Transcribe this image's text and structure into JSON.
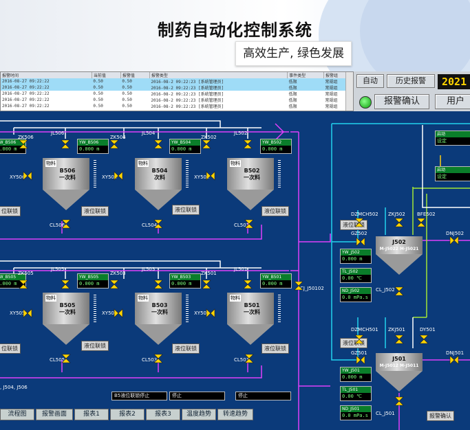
{
  "header": {
    "title": "制药自动化控制系统",
    "subtitle": "高效生产, 绿色发展"
  },
  "alarms": {
    "columns": [
      "报警时间",
      "当前值",
      "报警值",
      "报警类型",
      "事件类型",
      "报警组"
    ],
    "rows": [
      {
        "time": "2016-08-27 09:22:22",
        "cur": "0.50",
        "lim": "0.50",
        "msg": "2016-08-2 09:22:23 [系统管理员]",
        "type": "低限",
        "group": "常规组"
      },
      {
        "time": "2016-08-27 09:22:22",
        "cur": "0.50",
        "lim": "0.50",
        "msg": "2016-08-2 09:22:23 [系统管理员]",
        "type": "低限",
        "group": "常规组"
      },
      {
        "time": "2016-08-27 09:22:22",
        "cur": "0.50",
        "lim": "0.50",
        "msg": "2016-08-2 09:22:23 [系统管理员]",
        "type": "低限",
        "group": "常规组"
      },
      {
        "time": "2016-08-27 09:22:22",
        "cur": "0.50",
        "lim": "0.50",
        "msg": "2016-08-2 09:22:23 [系统管理员]",
        "type": "低限",
        "group": "常规组"
      },
      {
        "time": "2016-08-27 09:22:22",
        "cur": "0.50",
        "lim": "0.50",
        "msg": "2016-08-2 09:22:23 [系统管理员]",
        "type": "低限",
        "group": "常规组"
      }
    ]
  },
  "controls": {
    "btn_auto": "自动",
    "btn_history": "历史报警",
    "clock": "2021",
    "btn_ack": "报警确认",
    "user": "用户"
  },
  "tanks": {
    "b506": {
      "tag": "物料",
      "line1": "B506",
      "line2": "一次料"
    },
    "b504": {
      "tag": "物料",
      "line1": "B504",
      "line2": "次料"
    },
    "b502": {
      "tag": "物料",
      "line1": "B502",
      "line2": "一次料"
    },
    "b505": {
      "tag": "物料",
      "line1": "B505",
      "line2": "一次料"
    },
    "b503": {
      "tag": "物料",
      "line1": "B503",
      "line2": "一次料"
    },
    "b501": {
      "tag": "物料",
      "line1": "B501",
      "line2": "一次料"
    },
    "j502": {
      "tag": "",
      "line1": "J502",
      "line2": "M-J5022 M-J5021"
    },
    "j501": {
      "tag": "",
      "line1": "J501",
      "line2": "M-J5012 M-J5011"
    }
  },
  "labels": {
    "zk506": "ZK506",
    "jl506": "JL506",
    "zk504": "ZK504",
    "jl504": "JL504",
    "zk502": "ZK502",
    "jl502": "JL502",
    "xy506": "XY506",
    "xy504": "XY504",
    "xy502": "XY502",
    "cl506": "CL506",
    "cl504": "CL504",
    "cl502": "CL502",
    "zk505": "ZK505",
    "jl505": "JL505",
    "zk503": "ZK503",
    "jl503": "JL503",
    "zk501": "ZK501",
    "jl501": "JL501",
    "xy505": "XY505",
    "xy503": "XY503",
    "xy501": "XY501",
    "cl505": "CL505",
    "cl503": "CL503",
    "cl501": "CL501",
    "cj50102": "CJ_J50102",
    "dzmch502": "DZMCH502",
    "zkj502": "ZKJ502",
    "bfe502": "BFE502",
    "gz502": "GZ502",
    "dnj502": "DNJ502",
    "clj502": "CL_J502",
    "dzmch501": "DZMCH501",
    "zkj501": "ZKJ501",
    "dy501": "DY501",
    "gz501": "GZ501",
    "dnj501": "DNJ501",
    "clj501": "CL_J501",
    "left_note": ", J504, J506"
  },
  "displays": {
    "yw506": {
      "name": "YW_B506",
      "value": "0.000 m"
    },
    "yw504": {
      "name": "YW_B504",
      "value": "0.000 m"
    },
    "yw502": {
      "name": "YW_B502",
      "value": "0.000 m"
    },
    "yw505": {
      "name": "YW_B505",
      "value": "0.000 m"
    },
    "yw503": {
      "name": "YW_B503",
      "value": "0.000 m"
    },
    "yw501": {
      "name": "YW_B501",
      "value": "0.000 m"
    },
    "yw_j502": {
      "name": "YW_J502",
      "value": "0.000 m"
    },
    "tl_j502": {
      "name": "TL_J502",
      "value": "0.00 ℃"
    },
    "nd_j502": {
      "name": "ND_J502",
      "value": "0.0 mPa.s"
    },
    "yw_j501": {
      "name": "YW_J501",
      "value": "0.000 m"
    },
    "tl_j501": {
      "name": "TL_J501",
      "value": "0.00 ℃"
    },
    "nd_j501": {
      "name": "ND_J501",
      "value": "0.0 mPa.s"
    },
    "tr1_a": {
      "name": "启动",
      "value": "0.0"
    },
    "tr1_b": {
      "name": "设定",
      "value": "0.0"
    },
    "tr2_a": {
      "name": "启动",
      "value": "0.0"
    },
    "tr2_b": {
      "name": "设定",
      "value": "0.0"
    }
  },
  "buttons": {
    "b506_left": "位联锁",
    "b506_right": "液位联锁",
    "b504": "液位联锁",
    "b502": "液位联锁",
    "b505_left": "位联锁",
    "b505_right": "液位联锁",
    "b503": "液位联锁",
    "b501": "液位联锁",
    "j502": "液位联锁",
    "j501": "液位联锁",
    "ack": "报警确认"
  },
  "status": {
    "s1": "B5液位联锁停止",
    "s2": "停止",
    "s3": "停止"
  },
  "nav": [
    "流程图",
    "报警画面",
    "报表1",
    "报表2",
    "报表3",
    "温度趋势",
    "转速趋势"
  ]
}
